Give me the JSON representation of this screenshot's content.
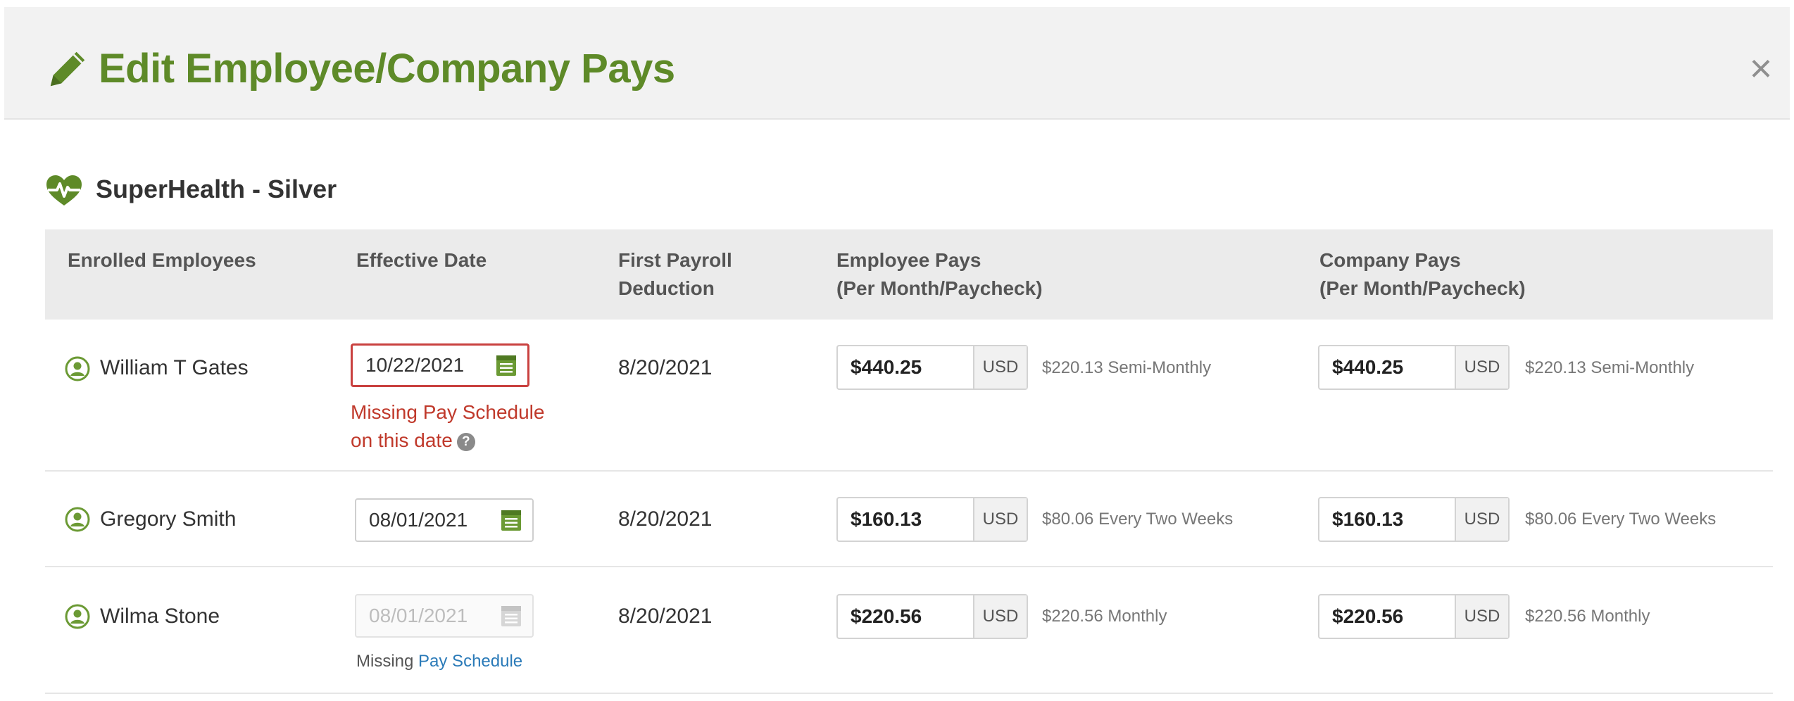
{
  "modal": {
    "title": "Edit Employee/Company Pays",
    "close_label": "×"
  },
  "plan": {
    "name": "SuperHealth - Silver"
  },
  "table": {
    "headers": {
      "enrolled": "Enrolled Employees",
      "effective": "Effective Date",
      "first_payroll_line1": "First Payroll",
      "first_payroll_line2": "Deduction",
      "employee_pays_line1": "Employee Pays",
      "employee_pays_line2": "(Per Month/Paycheck)",
      "company_pays_line1": "Company Pays",
      "company_pays_line2": "(Per Month/Paycheck)"
    },
    "rows": [
      {
        "name": "William T Gates",
        "effective_date": "10/22/2021",
        "error_line1": "Missing Pay Schedule",
        "error_line2": "on this date",
        "first_payroll": "8/20/2021",
        "employee_amount": "$440.25",
        "employee_currency": "USD",
        "employee_freq": "$220.13 Semi-Monthly",
        "company_amount": "$440.25",
        "company_currency": "USD",
        "company_freq": "$220.13 Semi-Monthly"
      },
      {
        "name": "Gregory Smith",
        "effective_date": "08/01/2021",
        "first_payroll": "8/20/2021",
        "employee_amount": "$160.13",
        "employee_currency": "USD",
        "employee_freq": "$80.06 Every Two Weeks",
        "company_amount": "$160.13",
        "company_currency": "USD",
        "company_freq": "$80.06 Every Two Weeks"
      },
      {
        "name": "Wilma Stone",
        "effective_date": "08/01/2021",
        "missing_prefix": "Missing",
        "missing_link": "Pay Schedule",
        "first_payroll": "8/20/2021",
        "employee_amount": "$220.56",
        "employee_currency": "USD",
        "employee_freq": "$220.56 Monthly",
        "company_amount": "$220.56",
        "company_currency": "USD",
        "company_freq": "$220.56 Monthly"
      }
    ]
  },
  "icons": {
    "pencil": "pencil-icon",
    "heart": "heartbeat-icon",
    "person": "person-circle-icon",
    "calendar": "calendar-icon",
    "help": "help-icon",
    "help_glyph": "?"
  },
  "colors": {
    "brand_green": "#5e8a28",
    "error_red": "#c0392b",
    "link_blue": "#2a7ab8"
  }
}
